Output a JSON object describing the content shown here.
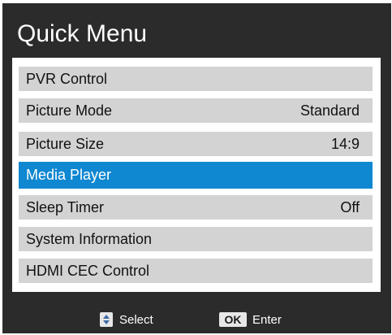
{
  "header": {
    "title": "Quick Menu"
  },
  "menu": {
    "items": [
      {
        "label": "PVR Control",
        "value": ""
      },
      {
        "label": "Picture Mode",
        "value": "Standard"
      },
      {
        "label": "Picture Size",
        "value": "14:9"
      },
      {
        "label": "Media Player",
        "value": "",
        "selected": true
      },
      {
        "label": "Sleep Timer",
        "value": "Off"
      },
      {
        "label": "System Information",
        "value": ""
      },
      {
        "label": "HDMI CEC Control",
        "value": ""
      }
    ]
  },
  "footer": {
    "select_label": "Select",
    "select_icon": "up-down-arrows-icon",
    "ok_key": "OK",
    "enter_label": "Enter"
  },
  "colors": {
    "background": "#2b2b2b",
    "item_bg": "#d3d3d3",
    "selected_bg": "#0f87d1",
    "text": "#111111",
    "title_text": "#ffffff"
  }
}
